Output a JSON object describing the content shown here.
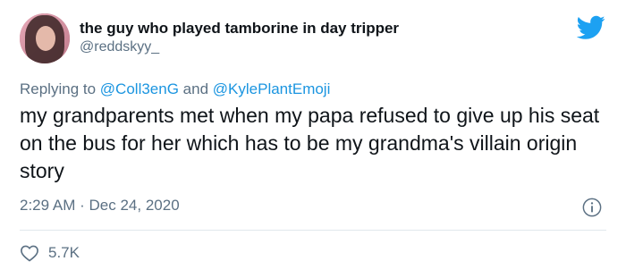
{
  "author": {
    "display_name": "the guy who played tamborine in day tripper",
    "handle": "@reddskyy_",
    "avatar_icon": "profile-photo"
  },
  "reply": {
    "prefix": "Replying to",
    "mention_1": "@Coll3enG",
    "joiner": "and",
    "mention_2": "@KylePlantEmoji"
  },
  "tweet": {
    "text": "my grandparents met when my papa refused to give up his seat on the bus for her which has to be my grandma's villain origin story",
    "time": "2:29 AM",
    "separator": "·",
    "date": "Dec 24, 2020"
  },
  "stats": {
    "likes": "5.7K"
  },
  "icons": {
    "brand": "twitter-bird-icon",
    "info": "info-icon",
    "like": "heart-icon"
  },
  "colors": {
    "brand": "#1da1f2",
    "link": "#1b95e0",
    "secondary_text": "#5b7083",
    "primary_text": "#0f1419",
    "divider": "#e1e8ed"
  }
}
